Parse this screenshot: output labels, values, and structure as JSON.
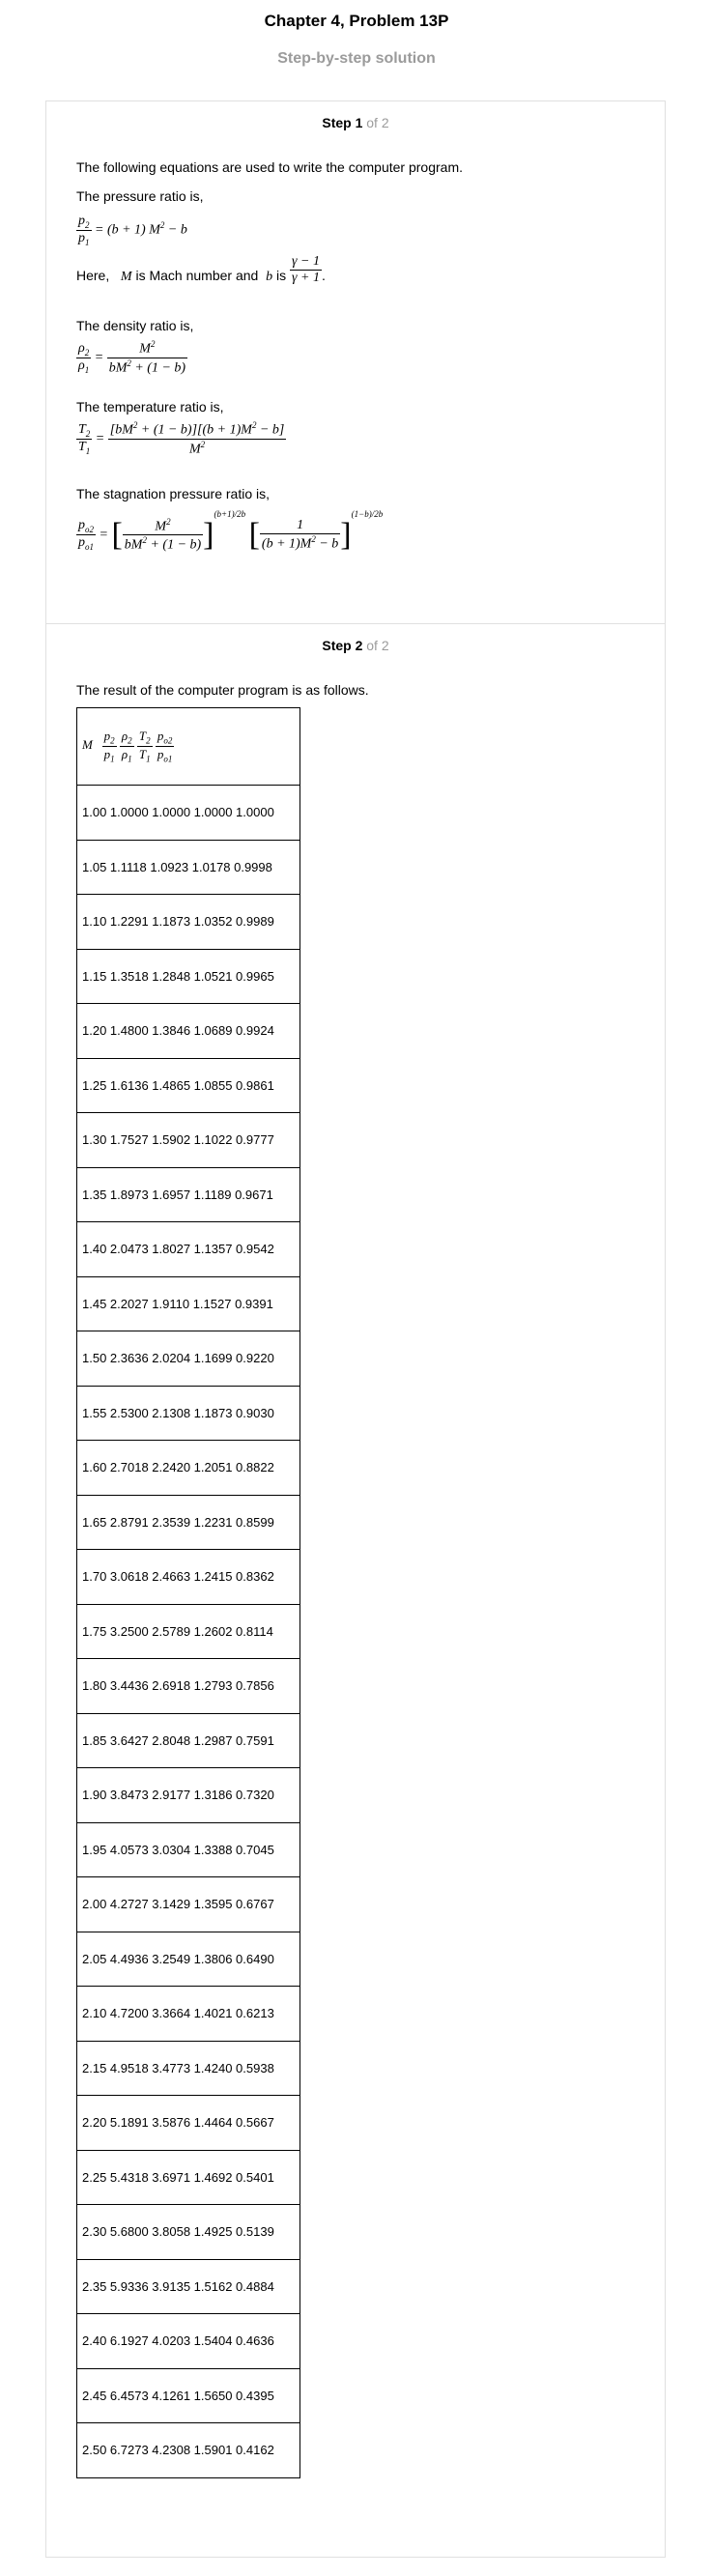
{
  "page": {
    "title": "Chapter 4, Problem 13P",
    "subtitle": "Step-by-step solution"
  },
  "step1": {
    "label": "Step 1",
    "of": "of 2",
    "intro": "The following equations are used to write the computer program.",
    "pressure_heading": "The pressure ratio is,",
    "here_text": "Here,",
    "mach_var": "M",
    "mach_text": "is Mach number and",
    "b_var": "b",
    "b_is": "is",
    "density_heading": "The density ratio is,",
    "temperature_heading": "The temperature ratio is,",
    "stagnation_heading": "The stagnation pressure ratio is,"
  },
  "step2": {
    "label": "Step 2",
    "of": "of 2",
    "intro": "The result of the computer program is as follows.",
    "rows": [
      "1.00 1.0000 1.0000 1.0000 1.0000",
      "1.05 1.1118 1.0923 1.0178 0.9998",
      "1.10 1.2291 1.1873 1.0352 0.9989",
      "1.15 1.3518 1.2848 1.0521 0.9965",
      "1.20 1.4800 1.3846 1.0689 0.9924",
      "1.25 1.6136 1.4865 1.0855 0.9861",
      "1.30 1.7527 1.5902 1.1022 0.9777",
      "1.35 1.8973 1.6957 1.1189 0.9671",
      "1.40 2.0473 1.8027 1.1357 0.9542",
      "1.45 2.2027 1.9110 1.1527 0.9391",
      "1.50 2.3636 2.0204 1.1699 0.9220",
      "1.55 2.5300 2.1308 1.1873 0.9030",
      "1.60 2.7018 2.2420 1.2051 0.8822",
      "1.65 2.8791 2.3539 1.2231 0.8599",
      "1.70 3.0618 2.4663 1.2415 0.8362",
      "1.75 3.2500 2.5789 1.2602 0.8114",
      "1.80 3.4436 2.6918 1.2793 0.7856",
      "1.85 3.6427 2.8048 1.2987 0.7591",
      "1.90 3.8473 2.9177 1.3186 0.7320",
      "1.95 4.0573 3.0304 1.3388 0.7045",
      "2.00 4.2727 3.1429 1.3595 0.6767",
      "2.05 4.4936 3.2549 1.3806 0.6490",
      "2.10 4.7200 3.3664 1.4021 0.6213",
      "2.15 4.9518 3.4773 1.4240 0.5938",
      "2.20 5.1891 3.5876 1.4464 0.5667",
      "2.25 5.4318 3.6971 1.4692 0.5401",
      "2.30 5.6800 3.8058 1.4925 0.5139",
      "2.35 5.9336 3.9135 1.5162 0.4884",
      "2.40 6.1927 4.0203 1.5404 0.4636",
      "2.45 6.4573 4.1261 1.5650 0.4395",
      "2.50 6.7273 4.2308 1.5901 0.4162"
    ]
  }
}
